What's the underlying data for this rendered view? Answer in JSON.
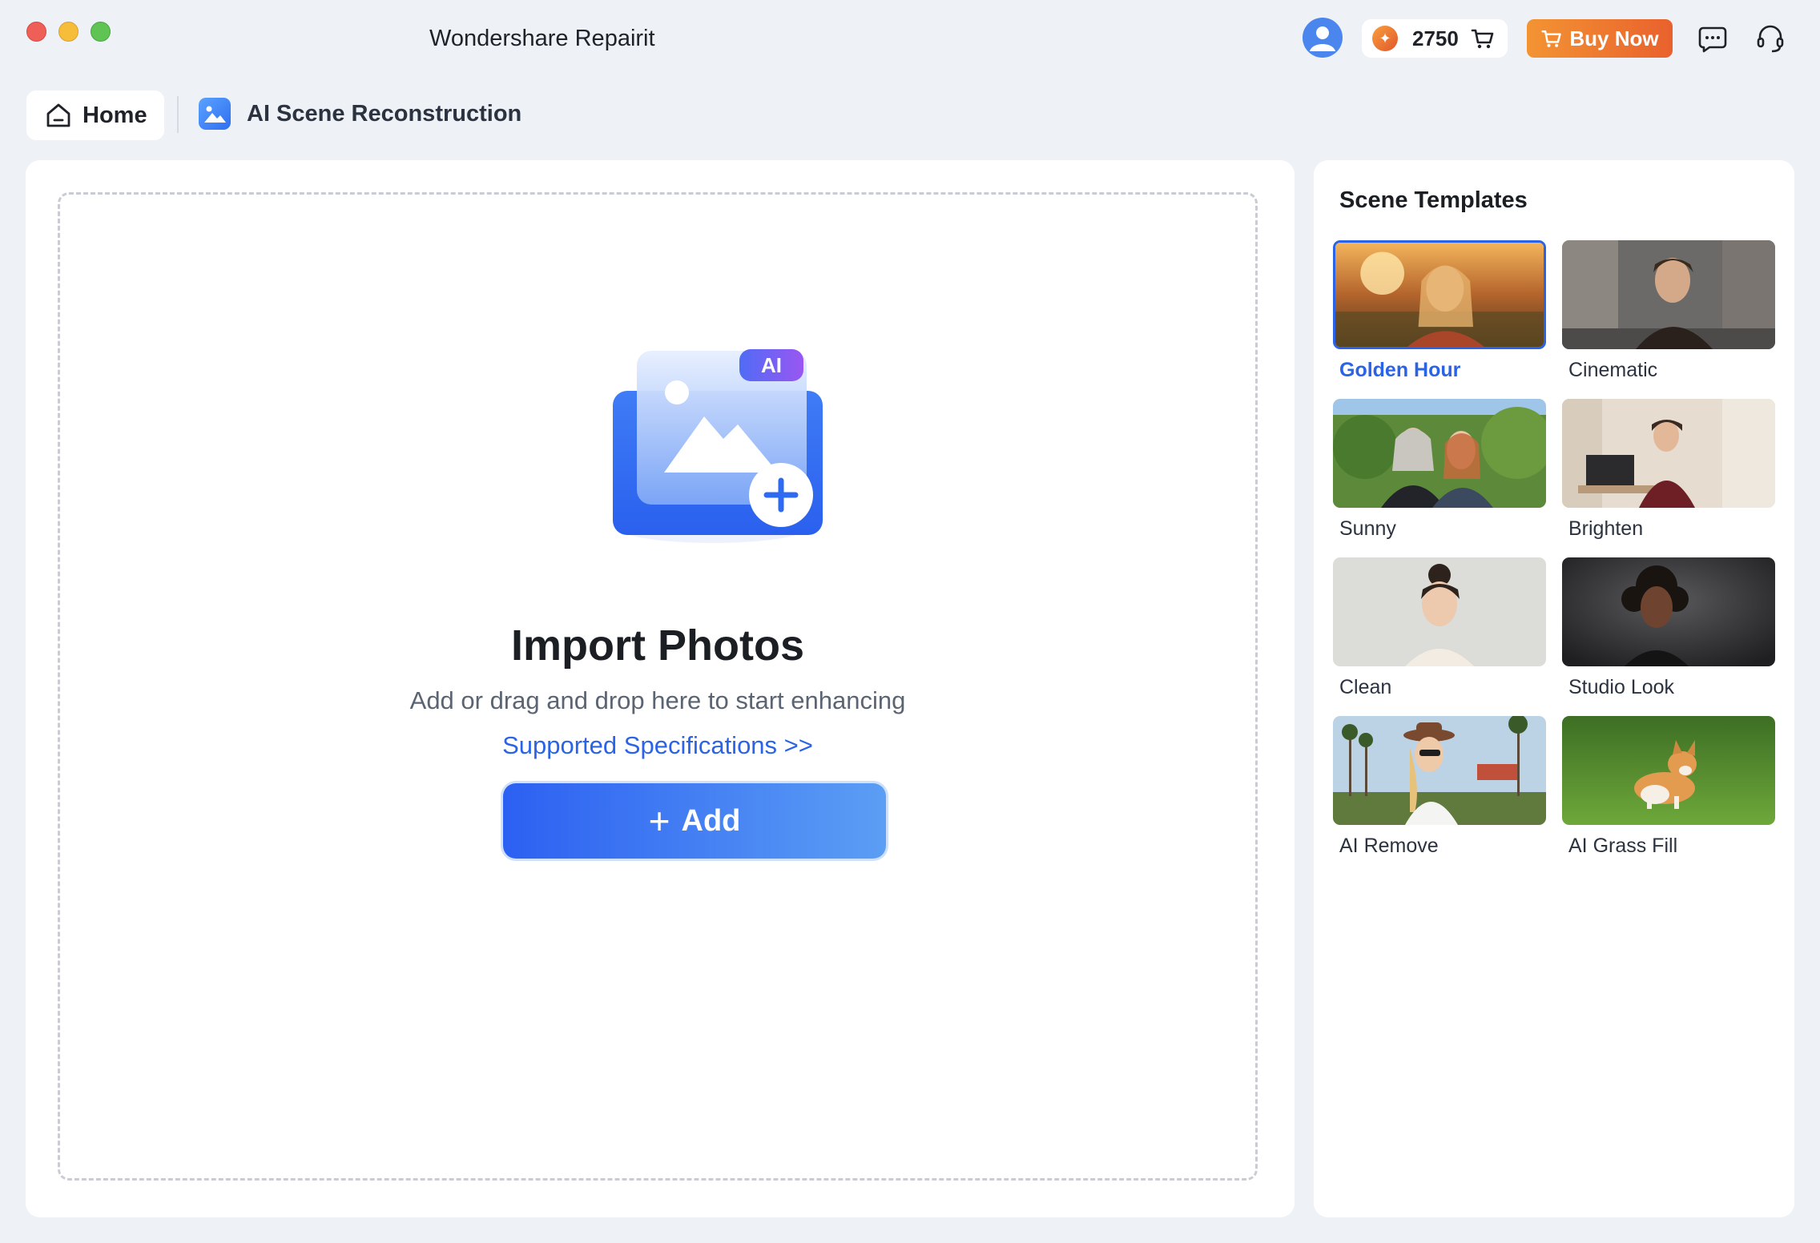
{
  "window": {
    "title": "Wondershare Repairit",
    "controls": [
      "close",
      "minimize",
      "maximize"
    ]
  },
  "header": {
    "credits": "2750",
    "buy_label": "Buy Now",
    "icons": [
      "user-avatar-icon",
      "credits-coin-icon",
      "cart-icon",
      "chat-icon",
      "support-headset-icon"
    ],
    "colors": {
      "buy_start": "#f39433",
      "buy_end": "#e9612d"
    }
  },
  "nav": {
    "home_label": "Home",
    "current_label": "AI Scene Reconstruction"
  },
  "main": {
    "badge": "AI",
    "title": "Import Photos",
    "subtitle": "Add or drag and drop here to start enhancing",
    "spec_link": "Supported Specifications >>",
    "add_label": "Add",
    "accent": "#2a63e6"
  },
  "templates": {
    "title": "Scene Templates",
    "selected": "Golden Hour",
    "items": [
      {
        "label": "Golden Hour"
      },
      {
        "label": "Cinematic"
      },
      {
        "label": "Sunny"
      },
      {
        "label": "Brighten"
      },
      {
        "label": "Clean"
      },
      {
        "label": "Studio Look"
      },
      {
        "label": "AI Remove"
      },
      {
        "label": "AI Grass Fill"
      }
    ]
  }
}
